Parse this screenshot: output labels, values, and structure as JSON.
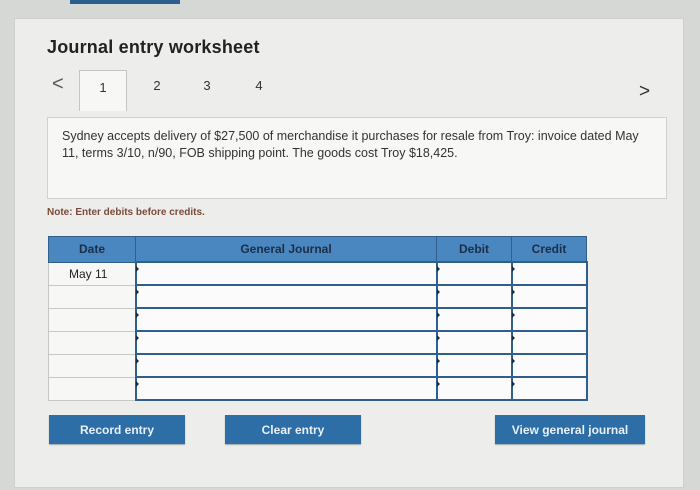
{
  "worksheet": {
    "title": "Journal entry worksheet",
    "tabs": [
      "1",
      "2",
      "3",
      "4"
    ],
    "active_tab": "1",
    "question": "Sydney accepts delivery of $27,500 of merchandise it purchases for resale from Troy: invoice dated May 11, terms 3/10, n/90, FOB shipping point. The goods cost Troy $18,425.",
    "note": "Note: Enter debits before credits."
  },
  "table": {
    "headers": {
      "date": "Date",
      "general_journal": "General Journal",
      "debit": "Debit",
      "credit": "Credit"
    },
    "rows": [
      {
        "date": "May 11"
      },
      {
        "date": ""
      },
      {
        "date": ""
      },
      {
        "date": ""
      },
      {
        "date": ""
      },
      {
        "date": ""
      }
    ]
  },
  "buttons": {
    "record": "Record entry",
    "clear": "Clear entry",
    "view": "View general journal"
  }
}
